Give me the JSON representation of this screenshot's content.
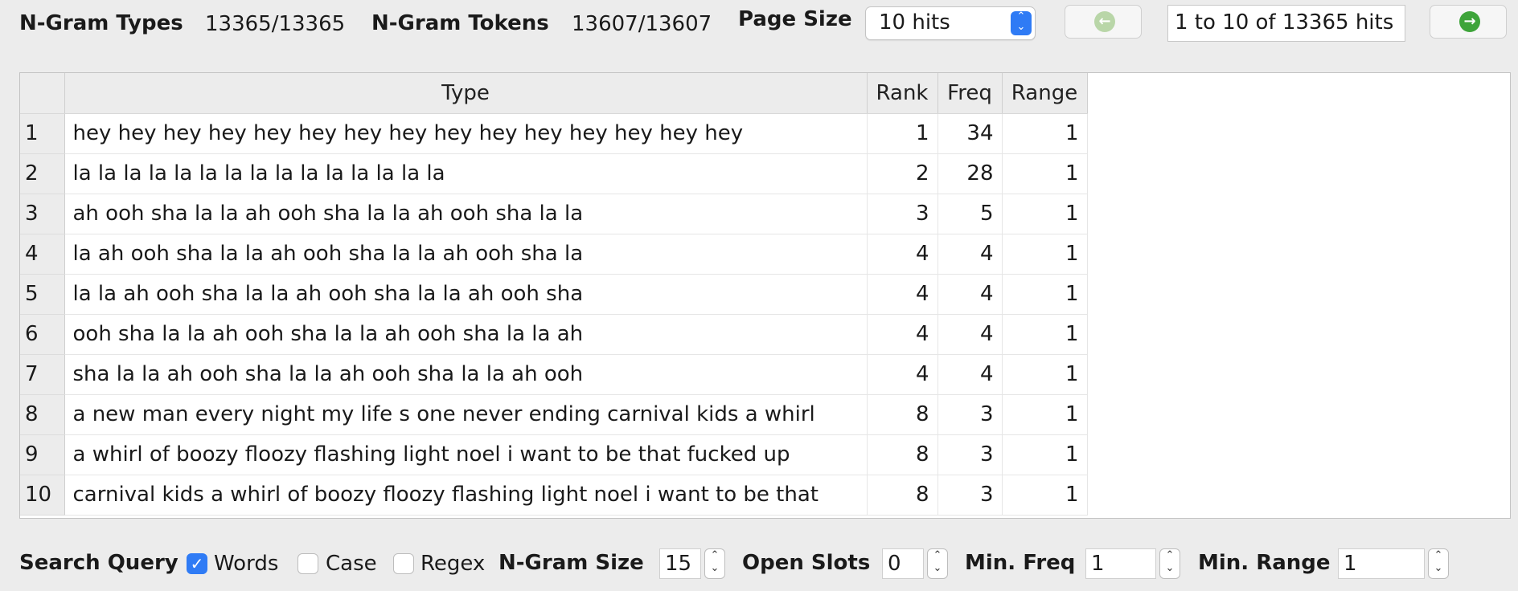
{
  "toolbar": {
    "ngram_types_label": "N-Gram Types",
    "ngram_types_value": "13365/13365",
    "ngram_tokens_label": "N-Gram Tokens",
    "ngram_tokens_value": "13607/13607",
    "page_size_label": "Page Size",
    "page_size_value": "10 hits",
    "prev_icon": "arrow-left-circle-icon",
    "next_icon": "arrow-right-circle-icon",
    "hits_text": "1 to 10 of 13365 hits",
    "prev_color": "#b9d6a8",
    "next_color": "#3ea43a"
  },
  "table": {
    "columns": [
      "Type",
      "Rank",
      "Freq",
      "Range"
    ],
    "rows": [
      {
        "n": "1",
        "type": "hey hey hey hey hey hey hey hey hey hey hey hey hey hey hey",
        "rank": "1",
        "freq": "34",
        "range": "1"
      },
      {
        "n": "2",
        "type": "la la la la la la la la la la la la la la la",
        "rank": "2",
        "freq": "28",
        "range": "1"
      },
      {
        "n": "3",
        "type": "ah ooh sha la la ah ooh sha la la ah ooh sha la la",
        "rank": "3",
        "freq": "5",
        "range": "1"
      },
      {
        "n": "4",
        "type": "la ah ooh sha la la ah ooh sha la la ah ooh sha la",
        "rank": "4",
        "freq": "4",
        "range": "1"
      },
      {
        "n": "5",
        "type": "la la ah ooh sha la la ah ooh sha la la ah ooh sha",
        "rank": "4",
        "freq": "4",
        "range": "1"
      },
      {
        "n": "6",
        "type": "ooh sha la la ah ooh sha la la ah ooh sha la la ah",
        "rank": "4",
        "freq": "4",
        "range": "1"
      },
      {
        "n": "7",
        "type": "sha la la ah ooh sha la la ah ooh sha la la ah ooh",
        "rank": "4",
        "freq": "4",
        "range": "1"
      },
      {
        "n": "8",
        "type": "a new man every night my life s one never ending carnival kids a whirl",
        "rank": "8",
        "freq": "3",
        "range": "1"
      },
      {
        "n": "9",
        "type": "a whirl of boozy floozy flashing light noel i want to be that fucked up",
        "rank": "8",
        "freq": "3",
        "range": "1"
      },
      {
        "n": "10",
        "type": "carnival kids a whirl of boozy floozy flashing light noel i want to be that",
        "rank": "8",
        "freq": "3",
        "range": "1"
      }
    ]
  },
  "search": {
    "label": "Search Query",
    "words_label": "Words",
    "words_checked": true,
    "case_label": "Case",
    "case_checked": false,
    "regex_label": "Regex",
    "regex_checked": false,
    "ngram_size_label": "N-Gram Size",
    "ngram_size_value": "15",
    "open_slots_label": "Open Slots",
    "open_slots_value": "0",
    "min_freq_label": "Min. Freq",
    "min_freq_value": "1",
    "min_range_label": "Min. Range",
    "min_range_value": "1"
  },
  "accent_color": "#2f7bf5"
}
